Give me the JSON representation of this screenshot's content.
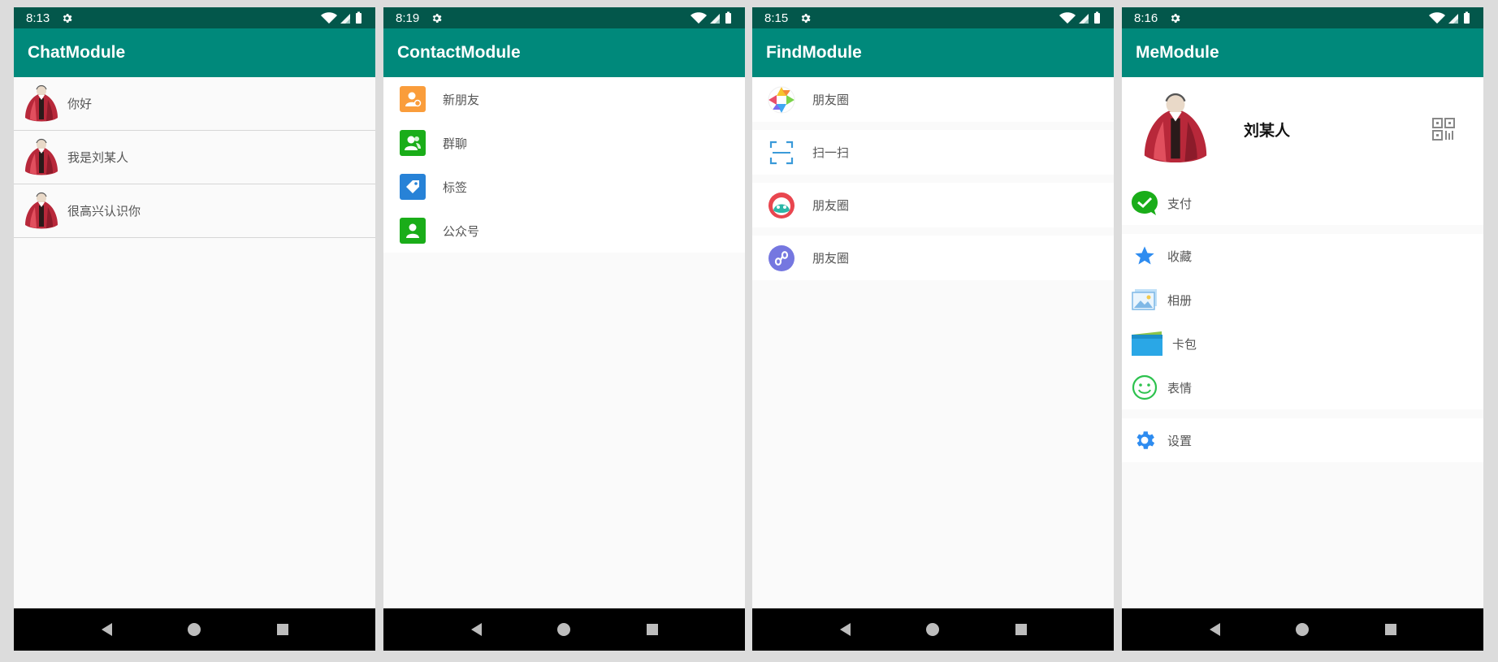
{
  "screens": [
    {
      "status_time": "8:13",
      "title": "ChatModule",
      "messages": [
        "你好",
        "我是刘某人",
        "很高兴认识你"
      ]
    },
    {
      "status_time": "8:19",
      "title": "ContactModule",
      "items": [
        {
          "label": "新朋友",
          "icon": "new-friend-icon",
          "color": "#fa9d3b"
        },
        {
          "label": "群聊",
          "icon": "group-chat-icon",
          "color": "#1aad19"
        },
        {
          "label": "标签",
          "icon": "tag-icon",
          "color": "#2782d7"
        },
        {
          "label": "公众号",
          "icon": "official-account-icon",
          "color": "#1aad19"
        }
      ]
    },
    {
      "status_time": "8:15",
      "title": "FindModule",
      "items": [
        {
          "label": "朋友圈",
          "icon": "moments-icon"
        },
        {
          "label": "扫一扫",
          "icon": "scan-icon"
        },
        {
          "label": "朋友圈",
          "icon": "game-icon"
        },
        {
          "label": "朋友圈",
          "icon": "mini-program-icon"
        }
      ]
    },
    {
      "status_time": "8:16",
      "title": "MeModule",
      "profile_name": "刘某人",
      "items": [
        {
          "label": "支付",
          "icon": "wechat-pay-icon"
        },
        {
          "label": "收藏",
          "icon": "star-icon"
        },
        {
          "label": "相册",
          "icon": "photo-album-icon"
        },
        {
          "label": "卡包",
          "icon": "card-wallet-icon"
        },
        {
          "label": "表情",
          "icon": "emoji-icon"
        },
        {
          "label": "设置",
          "icon": "settings-icon"
        }
      ]
    }
  ],
  "colors": {
    "status_bar": "#03574b",
    "app_bar": "#00897b",
    "nav_bar": "#000000",
    "background": "#fafafa"
  }
}
